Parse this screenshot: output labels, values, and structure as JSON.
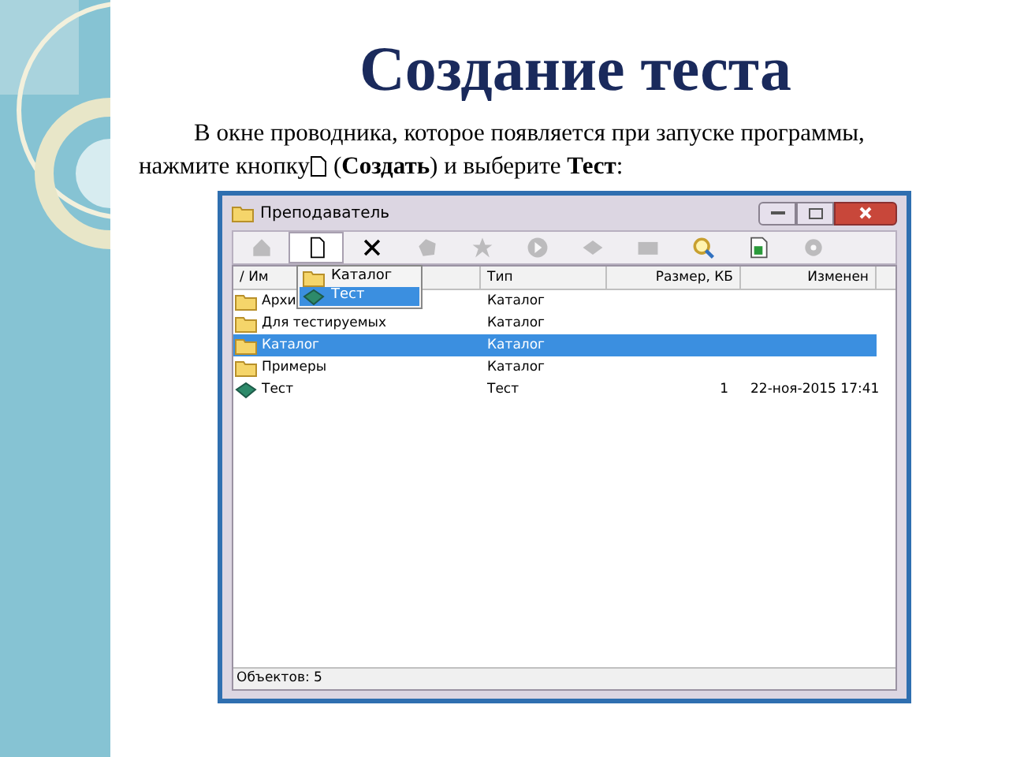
{
  "slide": {
    "title": "Создание теста",
    "instruction": {
      "line_1": "В окне проводника, которое появляется при запуске программы,",
      "line_2_before": "нажмите кнопку",
      "line_2_after": "(**Создать**) и выберите **Тест**:"
    }
  },
  "window": {
    "title": "Преподаватель",
    "toolbar": [
      {
        "disabled": true,
        "pressed": false
      },
      {
        "disabled": false,
        "pressed": true
      },
      {
        "disabled": false,
        "pressed": false
      },
      {
        "disabled": true,
        "pressed": false
      },
      {
        "disabled": true,
        "pressed": false
      },
      {
        "disabled": true,
        "pressed": false
      },
      {
        "disabled": true,
        "pressed": false
      },
      {
        "disabled": true,
        "pressed": false
      },
      {
        "disabled": false,
        "pressed": false
      },
      {
        "disabled": false,
        "pressed": false
      },
      {
        "disabled": true,
        "pressed": false
      }
    ],
    "columns": [
      "/ Им",
      "Тип",
      "Размер, КБ",
      "Изменен"
    ],
    "rows": [
      {
        "kind": "folder",
        "name": "Архи",
        "type": "Каталог",
        "selected": false
      },
      {
        "kind": "folder",
        "name": "Для тестируемых",
        "type": "Каталог",
        "selected": false
      },
      {
        "kind": "folder",
        "name": "Каталог",
        "type": "Каталог",
        "selected": true
      },
      {
        "kind": "folder",
        "name": "Примеры",
        "type": "Каталог",
        "selected": false
      },
      {
        "kind": "test",
        "name": "Тест",
        "type": "Тест",
        "size": "1",
        "modified": "22-ноя-2015 17:41",
        "selected": false
      }
    ],
    "menu": [
      {
        "kind": "folder",
        "label": "Каталог",
        "selected": false
      },
      {
        "kind": "test",
        "label": "Тест",
        "selected": true
      }
    ],
    "status_bar": "Объектов: 5"
  }
}
